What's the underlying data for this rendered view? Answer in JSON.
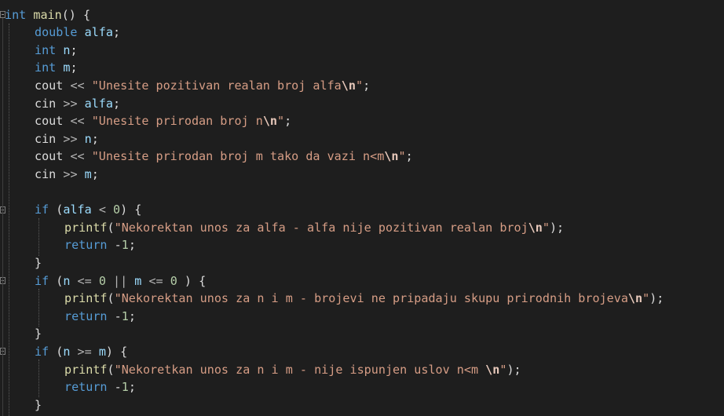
{
  "editor": {
    "theme": {
      "background": "#1e1e1e",
      "keyword": "#569cd6",
      "function": "#dcdcaa",
      "string": "#d69d85",
      "number": "#b5cea8",
      "variable": "#9cdcfe"
    },
    "lines": [
      {
        "tokens": [
          {
            "t": "int",
            "c": "kw"
          },
          {
            "t": " "
          },
          {
            "t": "main",
            "c": "fn"
          },
          {
            "t": "() {",
            "c": "pl"
          }
        ]
      },
      {
        "tokens": [
          {
            "t": "double",
            "c": "kw"
          },
          {
            "t": " "
          },
          {
            "t": "alfa",
            "c": "var"
          },
          {
            "t": ";",
            "c": "pl"
          }
        ]
      },
      {
        "tokens": [
          {
            "t": "int",
            "c": "kw"
          },
          {
            "t": " "
          },
          {
            "t": "n",
            "c": "var"
          },
          {
            "t": ";",
            "c": "pl"
          }
        ]
      },
      {
        "tokens": [
          {
            "t": "int",
            "c": "kw"
          },
          {
            "t": " "
          },
          {
            "t": "m",
            "c": "var"
          },
          {
            "t": ";",
            "c": "pl"
          }
        ]
      },
      {
        "tokens": [
          {
            "t": "cout",
            "c": "pl"
          },
          {
            "t": " << ",
            "c": "op"
          },
          {
            "t": "\"Unesite pozitivan realan broj alfa",
            "c": "str"
          },
          {
            "t": "\\n",
            "c": "esc"
          },
          {
            "t": "\"",
            "c": "str"
          },
          {
            "t": ";",
            "c": "pl"
          }
        ]
      },
      {
        "tokens": [
          {
            "t": "cin",
            "c": "pl"
          },
          {
            "t": " >> ",
            "c": "op"
          },
          {
            "t": "alfa",
            "c": "var"
          },
          {
            "t": ";",
            "c": "pl"
          }
        ]
      },
      {
        "tokens": [
          {
            "t": "cout",
            "c": "pl"
          },
          {
            "t": " << ",
            "c": "op"
          },
          {
            "t": "\"Unesite prirodan broj n",
            "c": "str"
          },
          {
            "t": "\\n",
            "c": "esc"
          },
          {
            "t": "\"",
            "c": "str"
          },
          {
            "t": ";",
            "c": "pl"
          }
        ]
      },
      {
        "tokens": [
          {
            "t": "cin",
            "c": "pl"
          },
          {
            "t": " >> ",
            "c": "op"
          },
          {
            "t": "n",
            "c": "var"
          },
          {
            "t": ";",
            "c": "pl"
          }
        ]
      },
      {
        "tokens": [
          {
            "t": "cout",
            "c": "pl"
          },
          {
            "t": " << ",
            "c": "op"
          },
          {
            "t": "\"Unesite prirodan broj m tako da vazi n<m",
            "c": "str"
          },
          {
            "t": "\\n",
            "c": "esc"
          },
          {
            "t": "\"",
            "c": "str"
          },
          {
            "t": ";",
            "c": "pl"
          }
        ]
      },
      {
        "tokens": [
          {
            "t": "cin",
            "c": "pl"
          },
          {
            "t": " >> ",
            "c": "op"
          },
          {
            "t": "m",
            "c": "var"
          },
          {
            "t": ";",
            "c": "pl"
          }
        ]
      },
      {
        "tokens": []
      },
      {
        "tokens": [
          {
            "t": "if",
            "c": "kw"
          },
          {
            "t": " (",
            "c": "pl"
          },
          {
            "t": "alfa",
            "c": "var"
          },
          {
            "t": " < ",
            "c": "op"
          },
          {
            "t": "0",
            "c": "num"
          },
          {
            "t": ") {",
            "c": "pl"
          }
        ]
      },
      {
        "tokens": [
          {
            "t": "printf",
            "c": "fn"
          },
          {
            "t": "(",
            "c": "pl"
          },
          {
            "t": "\"Nekorektan unos za alfa - alfa nije pozitivan realan broj",
            "c": "str"
          },
          {
            "t": "\\n",
            "c": "esc"
          },
          {
            "t": "\"",
            "c": "str"
          },
          {
            "t": ");",
            "c": "pl"
          }
        ]
      },
      {
        "tokens": [
          {
            "t": "return",
            "c": "kw"
          },
          {
            "t": " -",
            "c": "pl"
          },
          {
            "t": "1",
            "c": "num"
          },
          {
            "t": ";",
            "c": "pl"
          }
        ]
      },
      {
        "tokens": [
          {
            "t": "}",
            "c": "pl"
          }
        ]
      },
      {
        "tokens": [
          {
            "t": "if",
            "c": "kw"
          },
          {
            "t": " (",
            "c": "pl"
          },
          {
            "t": "n",
            "c": "var"
          },
          {
            "t": " <= ",
            "c": "op"
          },
          {
            "t": "0",
            "c": "num"
          },
          {
            "t": " || ",
            "c": "op"
          },
          {
            "t": "m",
            "c": "var"
          },
          {
            "t": " <= ",
            "c": "op"
          },
          {
            "t": "0",
            "c": "num"
          },
          {
            "t": " ) {",
            "c": "pl"
          }
        ]
      },
      {
        "tokens": [
          {
            "t": "printf",
            "c": "fn"
          },
          {
            "t": "(",
            "c": "pl"
          },
          {
            "t": "\"Nekorektan unos za n i m - brojevi ne pripadaju skupu prirodnih brojeva",
            "c": "str"
          },
          {
            "t": "\\n",
            "c": "esc"
          },
          {
            "t": "\"",
            "c": "str"
          },
          {
            "t": ");",
            "c": "pl"
          }
        ]
      },
      {
        "tokens": [
          {
            "t": "return",
            "c": "kw"
          },
          {
            "t": " -",
            "c": "pl"
          },
          {
            "t": "1",
            "c": "num"
          },
          {
            "t": ";",
            "c": "pl"
          }
        ]
      },
      {
        "tokens": [
          {
            "t": "}",
            "c": "pl"
          }
        ]
      },
      {
        "tokens": [
          {
            "t": "if",
            "c": "kw"
          },
          {
            "t": " (",
            "c": "pl"
          },
          {
            "t": "n",
            "c": "var"
          },
          {
            "t": " >= ",
            "c": "op"
          },
          {
            "t": "m",
            "c": "var"
          },
          {
            "t": ") {",
            "c": "pl"
          }
        ]
      },
      {
        "tokens": [
          {
            "t": "printf",
            "c": "fn"
          },
          {
            "t": "(",
            "c": "pl"
          },
          {
            "t": "\"Nekoretkan unos za n i m - nije ispunjen uslov n<m ",
            "c": "str"
          },
          {
            "t": "\\n",
            "c": "esc"
          },
          {
            "t": "\"",
            "c": "str"
          },
          {
            "t": ");",
            "c": "pl"
          }
        ]
      },
      {
        "tokens": [
          {
            "t": "return",
            "c": "kw"
          },
          {
            "t": " -",
            "c": "pl"
          },
          {
            "t": "1",
            "c": "num"
          },
          {
            "t": ";",
            "c": "pl"
          }
        ]
      },
      {
        "tokens": [
          {
            "t": "}",
            "c": "pl"
          }
        ]
      }
    ]
  }
}
